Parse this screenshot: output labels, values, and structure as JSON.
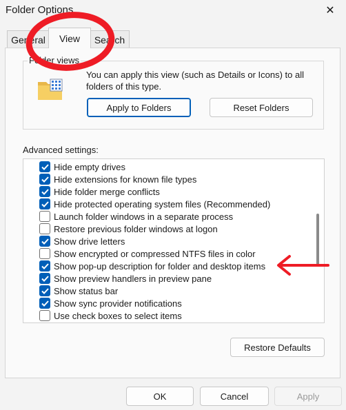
{
  "window": {
    "title": "Folder Options",
    "close_label": "✕"
  },
  "tabs": [
    {
      "label": "General"
    },
    {
      "label": "View"
    },
    {
      "label": "Search"
    }
  ],
  "folder_views": {
    "legend": "Folder views",
    "description": "You can apply this view (such as Details or Icons) to all folders of this type.",
    "apply_button": "Apply to Folders",
    "reset_button": "Reset Folders",
    "icon": "folder-grid-icon"
  },
  "advanced": {
    "label": "Advanced settings:",
    "items": [
      {
        "label": "Hide empty drives",
        "checked": true
      },
      {
        "label": "Hide extensions for known file types",
        "checked": true
      },
      {
        "label": "Hide folder merge conflicts",
        "checked": true
      },
      {
        "label": "Hide protected operating system files (Recommended)",
        "checked": true
      },
      {
        "label": "Launch folder windows in a separate process",
        "checked": false
      },
      {
        "label": "Restore previous folder windows at logon",
        "checked": false
      },
      {
        "label": "Show drive letters",
        "checked": true
      },
      {
        "label": "Show encrypted or compressed NTFS files in color",
        "checked": false
      },
      {
        "label": "Show pop-up description for folder and desktop items",
        "checked": true
      },
      {
        "label": "Show preview handlers in preview pane",
        "checked": true
      },
      {
        "label": "Show status bar",
        "checked": true
      },
      {
        "label": "Show sync provider notifications",
        "checked": true
      },
      {
        "label": "Use check boxes to select items",
        "checked": false
      }
    ],
    "restore_button": "Restore Defaults"
  },
  "footer": {
    "ok": "OK",
    "cancel": "Cancel",
    "apply": "Apply"
  },
  "colors": {
    "accent": "#005fb8",
    "annotation": "#ee1c25"
  }
}
